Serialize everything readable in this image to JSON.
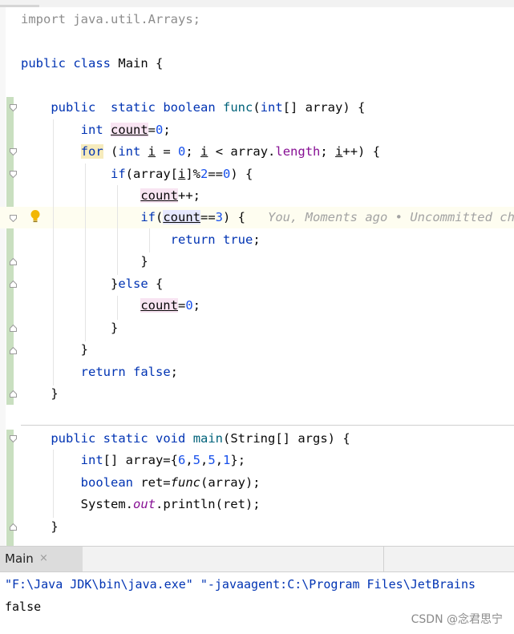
{
  "editor": {
    "import_kw": "import",
    "import_path": "java.util.Arrays;",
    "class_decl": {
      "public": "public",
      "class": "class",
      "name": "Main",
      "brace": "{"
    },
    "func_decl": {
      "public": "public",
      "static": "static",
      "boolean": "boolean",
      "name": "func",
      "params_open": "(",
      "int": "int",
      "params_rest": "[] array) {"
    },
    "count_decl": {
      "int": "int",
      "var": "count",
      "rest_a": "=",
      "zero": "0",
      "rest_b": ";"
    },
    "for_line": {
      "for": "for",
      "p1": " (",
      "int": "int",
      "i1": "i",
      "p2": " = ",
      "zero": "0",
      "p3": "; ",
      "i2": "i",
      "p4": " < array.",
      "length": "length",
      "p5": "; ",
      "i3": "i",
      "p6": "++) {"
    },
    "if_line": {
      "if": "if",
      "p1": "(array[",
      "i": "i",
      "p2": "]%",
      "two": "2",
      "p3": "==",
      "zero": "0",
      "p4": ") {"
    },
    "count_inc": {
      "var": "count",
      "rest": "++;"
    },
    "if_count": {
      "if": "if",
      "p1": "(",
      "var": "count",
      "p2": "==",
      "three": "3",
      "p3": ") {",
      "hint": "You, Moments ago • Uncommitted changes"
    },
    "return_true": {
      "return": "return",
      "true": "true",
      "semi": ";"
    },
    "close_brace": "}",
    "else_line": {
      "brace": "}",
      "else": "else",
      "rest": " {"
    },
    "count_reset": {
      "var": "count",
      "p1": "=",
      "zero": "0",
      "p2": ";"
    },
    "return_false": {
      "return": "return",
      "false": "false",
      "semi": ";"
    },
    "main_decl": {
      "public": "public",
      "static": "static",
      "void": "void",
      "name": "main",
      "rest": "(String[] args) {"
    },
    "array_decl": {
      "int": "int",
      "p1": "[] array={",
      "n1": "6",
      "c1": ",",
      "n2": "5",
      "c2": ",",
      "n3": "5",
      "c3": ",",
      "n4": "1",
      "p2": "};"
    },
    "ret_decl": {
      "boolean": "boolean",
      "p1": " ret=",
      "call": "func",
      "p2": "(array);"
    },
    "println": {
      "p1": "System.",
      "out": "out",
      "p2": ".println(ret);"
    }
  },
  "run_panel": {
    "tab_label": "Main",
    "close_glyph": "×",
    "command": "\"F:\\Java JDK\\bin\\java.exe\" \"-javaagent:C:\\Program Files\\JetBrains",
    "output": "false"
  },
  "watermark": "CSDN @念君思宁",
  "colors": {
    "keyword": "#0033b3",
    "number": "#1750eb",
    "method": "#00627a",
    "field": "#871094",
    "change_bar": "#c9dfc0",
    "current_line": "#fefdf0"
  }
}
